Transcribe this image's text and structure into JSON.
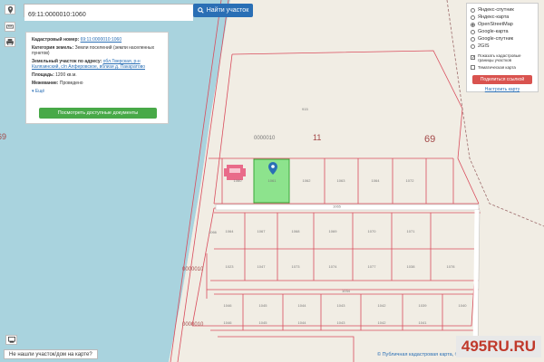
{
  "search": {
    "value": "69:11:0000010:1060",
    "button_label": "Найти участок"
  },
  "info_panel": {
    "cad_number_label": "Кадастровый номер:",
    "cad_number_value": "69:11:0000010:1060",
    "category_label": "Категория земель:",
    "category_value": "Земли поселений (земли населенных пунктов)",
    "address_label": "Земельный участок по адресу:",
    "address_value": "обл.Тверская, р-н Калязинский, с/п Алферовское, вблизи д. Пакаратово",
    "area_label": "Площадь:",
    "area_value": "1200 кв.м.",
    "boundary_label": "Межевание:",
    "boundary_value": "Проведено",
    "more_label": "Ещё",
    "docs_button": "Посмотреть доступные документы"
  },
  "layers": {
    "items": [
      {
        "label": "Яндекс-спутник",
        "selected": false
      },
      {
        "label": "Яндекс-карта",
        "selected": false
      },
      {
        "label": "OpenStreetMap",
        "selected": true
      },
      {
        "label": "Google-карта",
        "selected": false
      },
      {
        "label": "Google-спутник",
        "selected": false
      },
      {
        "label": "2GIS",
        "selected": false
      }
    ],
    "cadastral_borders_label": "Показать кадастровые границы участков",
    "cadastral_borders_checked": true,
    "thematic_label": "Тематическая карта",
    "thematic_checked": false,
    "share_button": "Поделиться ссылкой",
    "configure_link": "Настроить карту"
  },
  "map_labels": {
    "quarter": "0000010",
    "district": "11",
    "region": "69",
    "quarter_lower_1": "0000010",
    "quarter_lower_2": "0000010",
    "edge_mark": "69",
    "top_plot": "915",
    "road_plot": "1065",
    "side_plot": "1066",
    "row1": [
      "1060",
      "1061",
      "1062",
      "1063",
      "1064",
      "1072"
    ],
    "row2": [
      "1064",
      "1067",
      "1068",
      "1069",
      "1070",
      "1071"
    ],
    "row3": [
      "1023",
      "1047",
      "1073",
      "1074",
      "1077",
      "1038",
      "1078"
    ],
    "mid_strip": "1034",
    "row4": [
      "1046",
      "1045",
      "1044",
      "1043",
      "1042",
      "1039",
      "1040"
    ],
    "row5": [
      "1046",
      "1045",
      "1044",
      "1043",
      "1042",
      "1041"
    ]
  },
  "bottom": {
    "not_found_label": "Не нашли участок/дом на карте?",
    "attribution": "© Публичная кадастровая карта, © OpenStreetMap",
    "watermark": "495RU.RU"
  },
  "colors": {
    "sea": "#a9d3de",
    "land": "#f1ede4",
    "parcel_border": "#d94c5c",
    "selected_parcel": "#8de38d",
    "button_blue": "#2a6fb5",
    "button_green": "#48a948",
    "button_red": "#d9534f"
  },
  "icons": [
    "search-icon",
    "location-icon",
    "print-icon",
    "map-pin-icon",
    "fullscreen-icon"
  ]
}
